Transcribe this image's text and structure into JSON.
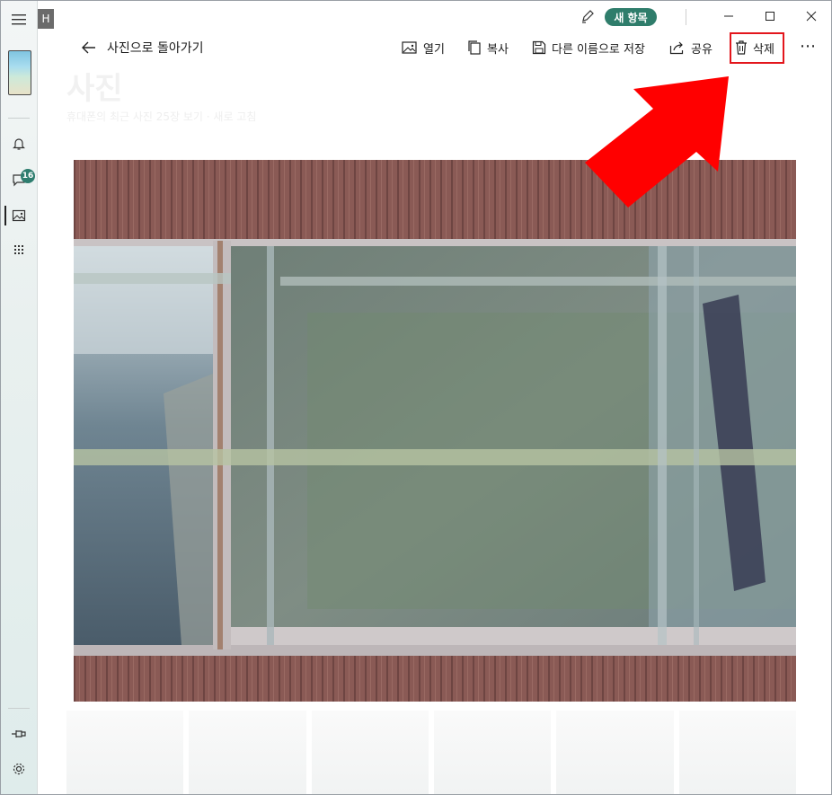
{
  "app": {
    "title_initial": "H",
    "new_item": "새 항목"
  },
  "nav": {
    "back_label": "사진으로 돌아가기"
  },
  "toolbar": {
    "open": "열기",
    "copy": "복사",
    "save_as": "다른 이름으로 저장",
    "share": "공유",
    "delete": "삭제",
    "more": "⋯"
  },
  "rail": {
    "messages_badge": "16"
  },
  "background": {
    "title": "사진",
    "subtitle": "휴대폰의 최근 사진 25장 보기 · 새로 고침"
  },
  "colors": {
    "accent": "#2f7d6b",
    "highlight": "#e3161c",
    "arrow": "#ff0000"
  },
  "icons": {
    "menu": "hamburger-icon",
    "notifications": "bell-icon",
    "messages": "chat-icon",
    "photos": "image-icon",
    "apps": "grid-icon",
    "pin": "pin-icon",
    "settings": "gear-icon"
  }
}
